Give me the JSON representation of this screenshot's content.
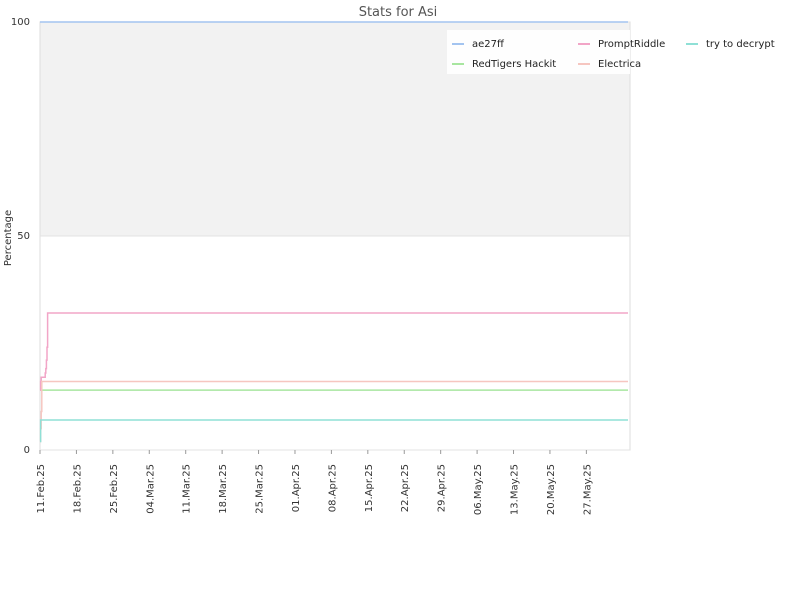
{
  "chart_data": {
    "type": "line",
    "title": "Stats for Asi",
    "xlabel": "",
    "ylabel": "Percentage",
    "ylim": [
      0,
      100
    ],
    "yticks": [
      "0",
      "50",
      "100"
    ],
    "x_start": "2025-02-11",
    "x_end": "2025-06-04",
    "xticks": [
      "11.Feb.25",
      "18.Feb.25",
      "25.Feb.25",
      "04.Mar.25",
      "11.Mar.25",
      "18.Mar.25",
      "25.Mar.25",
      "01.Apr.25",
      "08.Apr.25",
      "15.Apr.25",
      "22.Apr.25",
      "29.Apr.25",
      "06.May.25",
      "13.May.25",
      "20.May.25",
      "27.May.25"
    ],
    "shaded_band": [
      50,
      100
    ],
    "grid": "horizontal",
    "legend_position": "top-right",
    "series": [
      {
        "name": "ae27ff",
        "color": "#a3c4f0",
        "points": [
          [
            "2025-02-11",
            100
          ],
          [
            "2025-06-04",
            100
          ]
        ]
      },
      {
        "name": "RedTigers Hackit",
        "color": "#a8e6a0",
        "points": [
          [
            "2025-02-11",
            14
          ],
          [
            "2025-06-04",
            14
          ]
        ]
      },
      {
        "name": "PromptRiddle",
        "color": "#f2a5c7",
        "points": [
          [
            "2025-02-11",
            14
          ],
          [
            "2025-02-11",
            16
          ],
          [
            "2025-02-11",
            17
          ],
          [
            "2025-02-12",
            18
          ],
          [
            "2025-02-12",
            19
          ],
          [
            "2025-02-12",
            21
          ],
          [
            "2025-02-12",
            24
          ],
          [
            "2025-02-12",
            32
          ],
          [
            "2025-06-04",
            32
          ]
        ]
      },
      {
        "name": "Electrica",
        "color": "#f6c6c0",
        "points": [
          [
            "2025-02-11",
            2
          ],
          [
            "2025-02-11",
            5
          ],
          [
            "2025-02-11",
            9
          ],
          [
            "2025-02-11",
            16
          ],
          [
            "2025-06-04",
            16
          ]
        ]
      },
      {
        "name": "try to decrypt",
        "color": "#8fe0d6",
        "points": [
          [
            "2025-02-11",
            2
          ],
          [
            "2025-02-11",
            7
          ],
          [
            "2025-06-04",
            7
          ]
        ]
      }
    ]
  }
}
